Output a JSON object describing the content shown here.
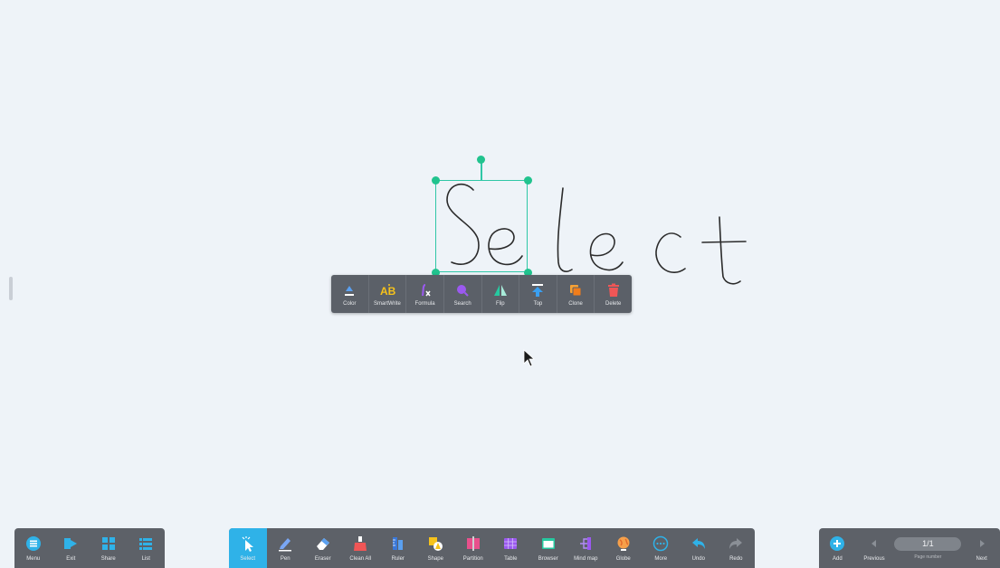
{
  "canvas": {
    "handwriting_text": "Select"
  },
  "context_menu": {
    "items": [
      {
        "label": "Color",
        "icon": "color-icon"
      },
      {
        "label": "SmartWrite",
        "icon": "smartwrite-icon"
      },
      {
        "label": "Formula",
        "icon": "formula-icon"
      },
      {
        "label": "Search",
        "icon": "search-icon"
      },
      {
        "label": "Flip",
        "icon": "flip-icon"
      },
      {
        "label": "Top",
        "icon": "top-icon"
      },
      {
        "label": "Clone",
        "icon": "clone-icon"
      },
      {
        "label": "Delete",
        "icon": "delete-icon"
      }
    ]
  },
  "left_bar": {
    "items": [
      {
        "label": "Menu",
        "icon": "menu-icon"
      },
      {
        "label": "Exit",
        "icon": "exit-icon"
      },
      {
        "label": "Share",
        "icon": "share-icon"
      },
      {
        "label": "List",
        "icon": "list-icon"
      }
    ]
  },
  "tools": {
    "selected": "Select",
    "items": [
      {
        "label": "Select",
        "icon": "select-icon"
      },
      {
        "label": "Pen",
        "icon": "pen-icon"
      },
      {
        "label": "Eraser",
        "icon": "eraser-icon"
      },
      {
        "label": "Clean All",
        "icon": "clean-all-icon"
      },
      {
        "label": "Ruler",
        "icon": "ruler-icon"
      },
      {
        "label": "Shape",
        "icon": "shape-icon"
      },
      {
        "label": "Partition",
        "icon": "partition-icon"
      },
      {
        "label": "Table",
        "icon": "table-icon"
      },
      {
        "label": "Browser",
        "icon": "browser-icon"
      },
      {
        "label": "Mind map",
        "icon": "mind-map-icon"
      },
      {
        "label": "Globe",
        "icon": "globe-icon"
      },
      {
        "label": "More",
        "icon": "more-icon"
      },
      {
        "label": "Undo",
        "icon": "undo-icon"
      },
      {
        "label": "Redo",
        "icon": "redo-icon"
      }
    ]
  },
  "right_bar": {
    "add_label": "Add",
    "previous_label": "Previous",
    "page_indicator": "1/1",
    "page_caption": "Page number",
    "next_label": "Next"
  },
  "colors": {
    "accent": "#2fb2e8",
    "selection": "#2fc7a6",
    "toolbar": "#5d6168",
    "background": "#eef3f8"
  }
}
